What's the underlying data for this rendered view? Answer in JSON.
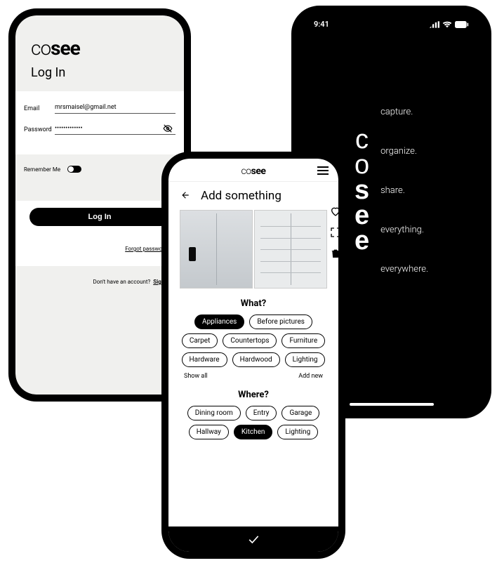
{
  "login": {
    "brand_thin": "co",
    "brand_bold": "see",
    "title": "Log In",
    "email_label": "Email",
    "email_value": "mrsmaisel@gmail.net",
    "password_label": "Password",
    "password_value": "•••••••••••••",
    "remember_label": "Remember Me",
    "login_button": "Log In",
    "forgot": "Forgot password?",
    "no_account": "Don't have an account?",
    "signup": "Sign Up"
  },
  "splash": {
    "time": "9:41",
    "taglines": [
      "capture.",
      "organize.",
      "share.",
      "everything.",
      "everywhere."
    ]
  },
  "add": {
    "brand_thin": "co",
    "brand_bold": "see",
    "title": "Add something",
    "what_heading": "What?",
    "what_chips": [
      "Appliances",
      "Before pictures",
      "Carpet",
      "Countertops",
      "Furniture",
      "Hardware",
      "Hardwood",
      "Lighting"
    ],
    "what_active": "Appliances",
    "show_all": "Show all",
    "add_new": "Add new",
    "where_heading": "Where?",
    "where_chips": [
      "Dining room",
      "Entry",
      "Garage",
      "Hallway",
      "Kitchen",
      "Lighting"
    ],
    "where_active": "Kitchen"
  }
}
